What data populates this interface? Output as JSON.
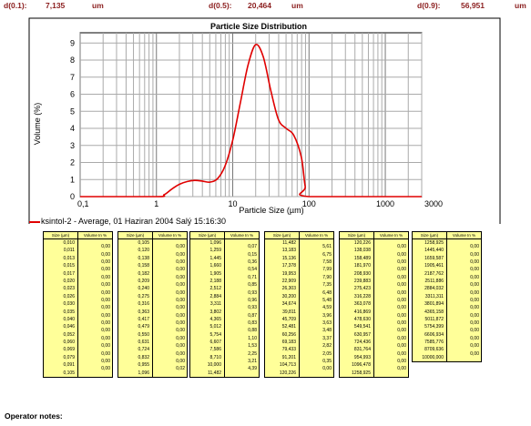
{
  "header": {
    "d01_label": "d(0.1):",
    "d01_value": "7,135",
    "d01_unit": "um",
    "d05_label": "d(0.5):",
    "d05_value": "20,464",
    "d05_unit": "um",
    "d09_label": "d(0.9):",
    "d09_value": "56,951",
    "d09_unit": "um"
  },
  "colors": {
    "header": "#8b1e1e",
    "series": "#e00000",
    "table_bg": "#ffff99"
  },
  "chart_data": {
    "type": "line",
    "title": "Particle Size Distribution",
    "xlabel": "Particle Size (µm)",
    "ylabel": "Volume (%)",
    "xscale": "log",
    "xlim": [
      0.1,
      3000
    ],
    "ylim": [
      0,
      9.6
    ],
    "x_ticks": [
      "0,1",
      "1",
      "10",
      "100",
      "1000",
      "3000"
    ],
    "y_ticks": [
      "0",
      "1",
      "2",
      "3",
      "4",
      "5",
      "6",
      "7",
      "8",
      "9"
    ],
    "grid": true,
    "series": [
      {
        "name": "ksintol-2 - Average, 01 Haziran 2004 Salý 15:16:30",
        "x": [
          0.1,
          1,
          1.26,
          1.585,
          1.995,
          2.512,
          3.162,
          3.981,
          5.012,
          6.31,
          7.943,
          10,
          12.589,
          15.849,
          19.953,
          25.119,
          31.623,
          39.811,
          50.119,
          63.096,
          79.433,
          89.125,
          100,
          3000
        ],
        "y": [
          0,
          0,
          0.11,
          0.44,
          0.72,
          0.88,
          0.95,
          0.91,
          0.85,
          1.05,
          1.8,
          3.3,
          5.5,
          7.7,
          8.9,
          8.2,
          6.2,
          4.5,
          4.0,
          3.6,
          2.3,
          0.6,
          0,
          0
        ]
      }
    ]
  },
  "tables": {
    "size_header": "Size (µm)",
    "volume_header": "Volume In %",
    "columns": [
      {
        "sizes": [
          "0,010",
          "0,011",
          "0,013",
          "0,015",
          "0,017",
          "0,020",
          "0,023",
          "0,026",
          "0,030",
          "0,035",
          "0,040",
          "0,046",
          "0,052",
          "0,060",
          "0,069",
          "0,079",
          "0,091",
          "0,105"
        ],
        "volumes": [
          "0,00",
          "0,00",
          "0,00",
          "0,00",
          "0,00",
          "0,00",
          "0,00",
          "0,00",
          "0,00",
          "0,00",
          "0,00",
          "0,00",
          "0,00",
          "0,00",
          "0,00",
          "0,00",
          "0,00"
        ]
      },
      {
        "sizes": [
          "0,105",
          "0,120",
          "0,138",
          "0,158",
          "0,182",
          "0,209",
          "0,240",
          "0,275",
          "0,316",
          "0,363",
          "0,417",
          "0,479",
          "0,550",
          "0,631",
          "0,724",
          "0,832",
          "0,955",
          "1,096"
        ],
        "volumes": [
          "0,00",
          "0,00",
          "0,00",
          "0,00",
          "0,00",
          "0,00",
          "0,00",
          "0,00",
          "0,00",
          "0,00",
          "0,00",
          "0,00",
          "0,00",
          "0,00",
          "0,00",
          "0,00",
          "0,02"
        ]
      },
      {
        "sizes": [
          "1,096",
          "1,259",
          "1,445",
          "1,660",
          "1,905",
          "2,188",
          "2,512",
          "2,884",
          "3,311",
          "3,802",
          "4,365",
          "5,012",
          "5,754",
          "6,607",
          "7,586",
          "8,710",
          "10,000",
          "11,482"
        ],
        "volumes": [
          "0,07",
          "0,15",
          "0,36",
          "0,54",
          "0,71",
          "0,85",
          "0,93",
          "0,96",
          "0,93",
          "0,87",
          "0,83",
          "0,88",
          "1,10",
          "1,53",
          "2,25",
          "3,21",
          "4,39"
        ]
      },
      {
        "sizes": [
          "11,482",
          "13,183",
          "15,136",
          "17,378",
          "19,953",
          "22,909",
          "26,303",
          "30,200",
          "34,674",
          "39,811",
          "45,709",
          "52,481",
          "60,256",
          "69,183",
          "79,433",
          "91,201",
          "104,713",
          "120,226"
        ],
        "volumes": [
          "5,61",
          "6,75",
          "7,58",
          "7,99",
          "7,90",
          "7,35",
          "6,48",
          "5,48",
          "4,59",
          "3,96",
          "3,63",
          "3,48",
          "3,37",
          "2,82",
          "2,05",
          "0,35",
          "0,00"
        ]
      },
      {
        "sizes": [
          "120,226",
          "138,038",
          "158,489",
          "181,970",
          "208,930",
          "239,883",
          "275,423",
          "316,228",
          "363,078",
          "416,869",
          "478,630",
          "549,541",
          "630,957",
          "724,436",
          "831,764",
          "954,993",
          "1096,478",
          "1258,925"
        ],
        "volumes": [
          "0,00",
          "0,00",
          "0,00",
          "0,00",
          "0,00",
          "0,00",
          "0,00",
          "0,00",
          "0,00",
          "0,00",
          "0,00",
          "0,00",
          "0,00",
          "0,00",
          "0,00",
          "0,00",
          "0,00"
        ]
      },
      {
        "sizes": [
          "1258,925",
          "1445,440",
          "1659,587",
          "1905,461",
          "2187,762",
          "2511,886",
          "2884,032",
          "3311,311",
          "3801,894",
          "4365,158",
          "5011,872",
          "5754,399",
          "6606,934",
          "7585,776",
          "8709,636",
          "10000,000"
        ],
        "volumes": [
          "0,00",
          "0,00",
          "0,00",
          "0,00",
          "0,00",
          "0,00",
          "0,00",
          "0,00",
          "0,00",
          "0,00",
          "0,00",
          "0,00",
          "0,00",
          "0,00",
          "0,00"
        ]
      }
    ]
  },
  "notes_label": "Operator notes:"
}
